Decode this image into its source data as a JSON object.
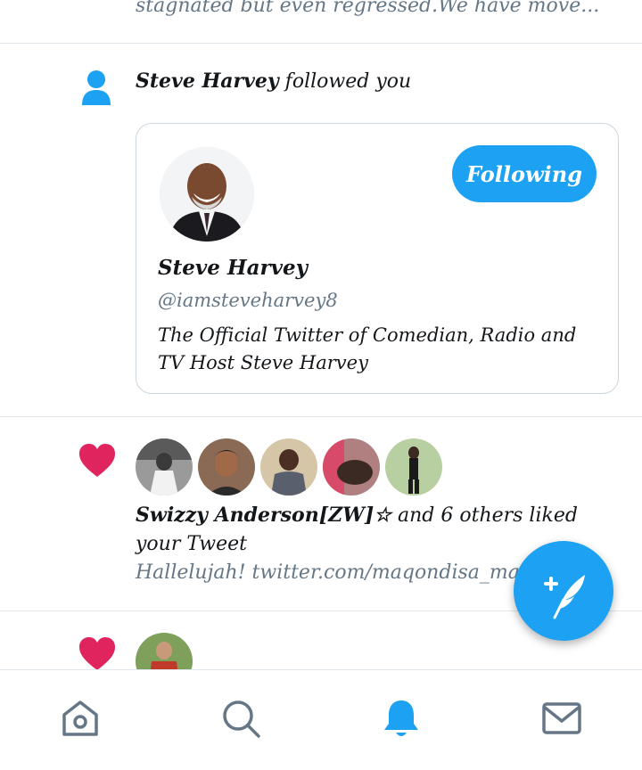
{
  "top_snippet": {
    "text": "stagnated but even regressed.We have move..."
  },
  "follow_notification": {
    "name": "Steve Harvey",
    "action": " followed you",
    "card": {
      "name": "Steve Harvey",
      "handle": "@iamsteveharvey8",
      "bio": "The Official Twitter of Comedian, Radio and TV Host Steve Harvey",
      "button_label": "Following"
    }
  },
  "like_notification": {
    "name": "Swizzy Anderson[ZW]☆",
    "action": " and 6 others liked your Tweet",
    "tweet": "Hallelujah! twitter.com/maqondisa_ma"
  },
  "colors": {
    "accent": "#1da1f2",
    "like": "#e0245e",
    "muted": "#657786",
    "divider": "#e1e8ed"
  },
  "icons": {
    "follow": "person-icon",
    "like": "heart-icon",
    "compose": "compose-feather-icon",
    "nav": [
      "home-icon",
      "search-icon",
      "notifications-bell-icon",
      "messages-envelope-icon"
    ]
  }
}
